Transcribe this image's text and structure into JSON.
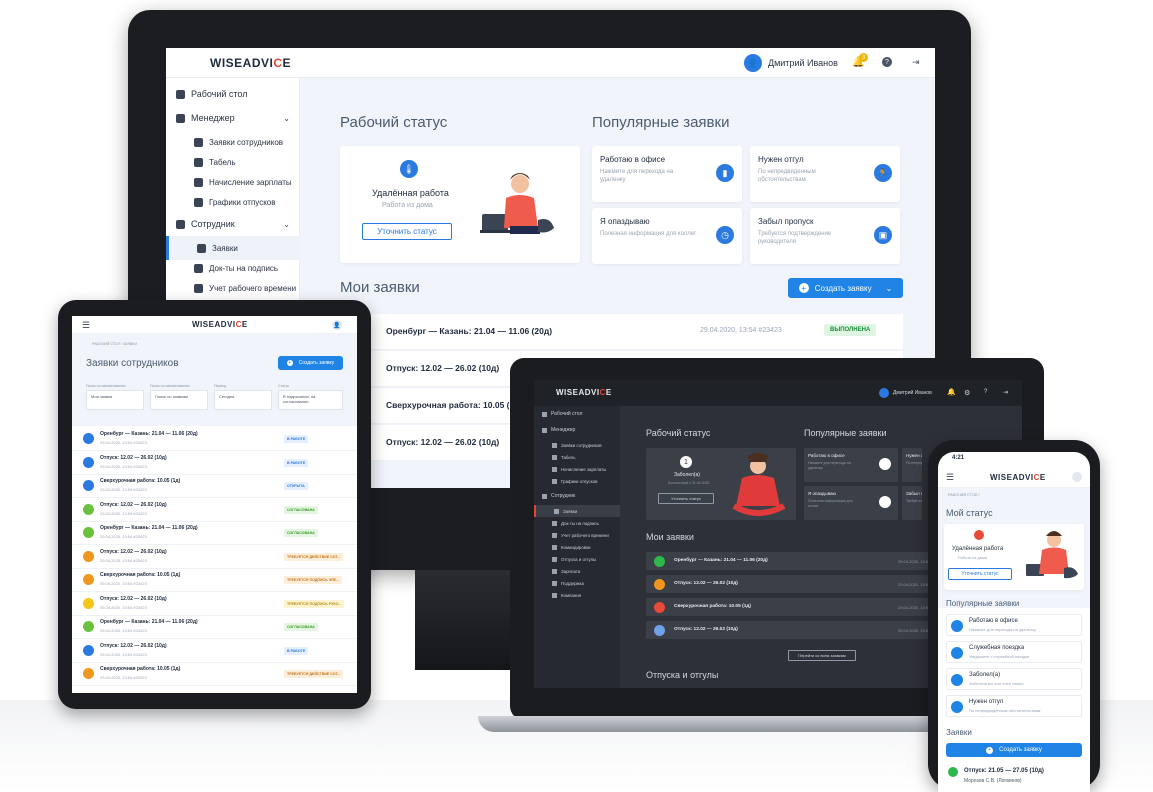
{
  "brand": {
    "prefix": "WISEADV",
    "k": "I",
    "ke": "C",
    "suffix": "E"
  },
  "monitor": {
    "user_name": "Дмитрий Иванов",
    "notif_count": "3",
    "sidebar": [
      {
        "label": "Рабочий стол",
        "level": 0
      },
      {
        "label": "Менеджер",
        "level": 0,
        "chevron": "⌄"
      },
      {
        "label": "Заявки сотрудников",
        "level": 1
      },
      {
        "label": "Табель",
        "level": 1
      },
      {
        "label": "Начисление зарплаты",
        "level": 1
      },
      {
        "label": "Графики отпусков",
        "level": 1
      },
      {
        "label": "Сотрудник",
        "level": 0,
        "chevron": "⌄"
      },
      {
        "label": "Заявки",
        "level": 1,
        "active": true
      },
      {
        "label": "Док-ты на подпись",
        "level": 1
      },
      {
        "label": "Учет рабочего времени",
        "level": 1
      }
    ],
    "status_title": "Рабочий статус",
    "status_card": {
      "title": "Удалённая работа",
      "subtitle": "Работа из дома",
      "button": "Уточнить статус"
    },
    "popular_title": "Популярные заявки",
    "popular": [
      {
        "title": "Работаю в офисе",
        "desc": "Нажмите для перехода на удаленку",
        "icon": "▮"
      },
      {
        "title": "Нужен отгул",
        "desc": "По непредвиденным обстоятельствам",
        "icon": "🏃"
      },
      {
        "title": "Я опаздываю",
        "desc": "Полезная информация для коллег",
        "icon": "◷"
      },
      {
        "title": "Забыл пропуск",
        "desc": "Требуется подтверждение руководителя",
        "icon": "▣"
      }
    ],
    "my_title": "Мои заявки",
    "create_btn": "Создать заявку",
    "rows": [
      {
        "title": "Оренбург — Казань: 21.04 — 11.06 (20д)",
        "date": "29.04.2020, 13:54 #23423",
        "badge": "ВЫПОЛНЕНА",
        "color": "#2eb84b"
      },
      {
        "title": "Отпуск: 12.02 — 26.02 (10д)",
        "date": "",
        "badge": "",
        "color": "#f5a623"
      },
      {
        "title": "Сверхурочная работа: 10.05 (1д",
        "date": "",
        "badge": "",
        "color": "#e84b3a"
      },
      {
        "title": "Отпуск: 12.02 — 26.02 (10д)",
        "date": "",
        "badge": "",
        "color": "#2a7ae2"
      }
    ]
  },
  "tablet": {
    "breadcrumb": "РАБОЧИЙ СТОЛ  /  ЗАЯВКИ",
    "title": "Заявки сотрудников",
    "create_btn": "Создать заявку",
    "filters": [
      {
        "label": "Поиск по наименованию",
        "value": "Мои заявки"
      },
      {
        "label": "Поиск по наименованию",
        "value": "Поиск по заявкам"
      },
      {
        "label": "Период",
        "value": "Сегодня"
      },
      {
        "label": "Статус",
        "value": "В подписании, на согласовании"
      }
    ],
    "rows": [
      {
        "title": "Оренбург — Казань: 21.04 — 11.06 (20д)",
        "date": "29.04.2020, 13:54 #23423",
        "badge": "В РАБОТЕ",
        "color": "#2a7ae2",
        "bbg": "#e4efff",
        "bfg": "#2a7ae2"
      },
      {
        "title": "Отпуск: 12.02 — 26.02 (10д)",
        "date": "29.04.2020, 13:54 #23423",
        "badge": "В РАБОТЕ",
        "color": "#2a7ae2",
        "bbg": "#e4efff",
        "bfg": "#2a7ae2"
      },
      {
        "title": "Сверхурочная работа: 10.05 (1д)",
        "date": "29.04.2020, 13:54 #23423",
        "badge": "ОТКРЫТА",
        "color": "#2a7ae2",
        "bbg": "#e4efff",
        "bfg": "#2a7ae2"
      },
      {
        "title": "Отпуск: 12.02 — 26.02 (10д)",
        "date": "29.04.2020, 13:54 #23423",
        "badge": "СОГЛАСОВАНА",
        "color": "#69c23b",
        "bbg": "#e3f6df",
        "bfg": "#3a9a2c"
      },
      {
        "title": "Оренбург — Казань: 21.04 — 11.06 (20д)",
        "date": "29.04.2020, 13:54 #23423",
        "badge": "СОГЛАСОВАНА",
        "color": "#69c23b",
        "bbg": "#e3f6df",
        "bfg": "#3a9a2c"
      },
      {
        "title": "Отпуск: 12.02 — 26.02 (10д)",
        "date": "29.04.2020, 13:54 #23423",
        "badge": "ТРЕБУЕТСЯ ДЕЙСТВИЕ СОТ...",
        "color": "#f0961f",
        "bbg": "#fdeed9",
        "bfg": "#c4741a"
      },
      {
        "title": "Сверхурочная работа: 10.05 (1д)",
        "date": "29.04.2020, 13:54 #23423",
        "badge": "ТРЕБУЕТСЯ ПОДПИСЬ ЭЛЕ...",
        "color": "#f0961f",
        "bbg": "#fdeed9",
        "bfg": "#c4741a"
      },
      {
        "title": "Отпуск: 12.02 — 26.02 (10д)",
        "date": "29.04.2020, 13:54 #23423",
        "badge": "ТРЕБУЕТСЯ ПОДПИСЬ РУКО...",
        "color": "#f5c518",
        "bbg": "#fdf3d0",
        "bfg": "#b88f0a"
      },
      {
        "title": "Оренбург — Казань: 21.04 — 11.06 (20д)",
        "date": "29.04.2020, 13:54 #23423",
        "badge": "СОГЛАСОВАНА",
        "color": "#69c23b",
        "bbg": "#e3f6df",
        "bfg": "#3a9a2c"
      },
      {
        "title": "Отпуск: 12.02 — 26.02 (10д)",
        "date": "29.04.2020, 13:54 #23423",
        "badge": "В РАБОТЕ",
        "color": "#2a7ae2",
        "bbg": "#e4efff",
        "bfg": "#2a7ae2"
      },
      {
        "title": "Сверхурочная работа: 10.05 (1д)",
        "date": "29.04.2020, 13:54 #23423",
        "badge": "ТРЕБУЕТСЯ ДЕЙСТВИЕ СОТ...",
        "color": "#f0961f",
        "bbg": "#fdeed9",
        "bfg": "#c4741a"
      }
    ]
  },
  "laptop": {
    "user_name": "Дмитрий Иванов",
    "sidebar": [
      {
        "label": "Рабочий стол",
        "level": 0
      },
      {
        "label": "Менеджер",
        "level": 0
      },
      {
        "label": "Заявки сотрудников",
        "level": 1
      },
      {
        "label": "Табель",
        "level": 1
      },
      {
        "label": "Начисление зарплаты",
        "level": 1
      },
      {
        "label": "Графики отпусков",
        "level": 1
      },
      {
        "label": "Сотрудник",
        "level": 0
      },
      {
        "label": "Заявки",
        "level": 1,
        "active": true
      },
      {
        "label": "Док-ты на подпись",
        "level": 1
      },
      {
        "label": "Учет рабочего времени",
        "level": 1
      },
      {
        "label": "Командировки",
        "level": 1
      },
      {
        "label": "Отпуска и отгулы",
        "level": 1
      },
      {
        "label": "Зарплата",
        "level": 1
      },
      {
        "label": "Поддержка",
        "level": 1
      },
      {
        "label": "Компания",
        "level": 1
      }
    ],
    "status_title": "Рабочий статус",
    "status_card": {
      "title": "Заболел(а)",
      "subtitle": "Больничный с 21.04.2020",
      "button": "Уточнить статус"
    },
    "popular_title": "Популярные заявки",
    "popular": [
      {
        "title": "Работаю в офисе",
        "desc": "Нажмите для перехода на удаленку"
      },
      {
        "title": "Нужен от",
        "desc": "По непредв обстоят"
      },
      {
        "title": "Я опаздываю",
        "desc": "Полезная информация для коллег"
      },
      {
        "title": "Забыл пр",
        "desc": "Требуется руководит"
      }
    ],
    "my_title": "Мои заявки",
    "rows": [
      {
        "title": "Оренбург — Казань: 21.04 — 11.06 (20д)",
        "date": "29.04.2020, 13:54 #23423",
        "color": "#2eb84b"
      },
      {
        "title": "Отпуск: 12.02 — 26.02 (10д)",
        "date": "29.04.2020, 13:54 #23423",
        "color": "#f0961f"
      },
      {
        "title": "Сверхурочная работа: 10.05 (1д)",
        "date": "29.04.2020, 13:54 #23423",
        "color": "#e84b3a"
      },
      {
        "title": "Отпуск: 12.02 — 26.02 (10д)",
        "date": "29.04.2020, 13:54 #23423",
        "color": "#6fa2e6"
      }
    ],
    "all_btn": "Перейти ко всем заявкам",
    "vacation_title": "Отпуска и отгулы"
  },
  "phone": {
    "time": "4:21",
    "breadcrumb": "РАБОЧИЙ СТОЛ  /",
    "status_title": "Мой статус",
    "status_card": {
      "title": "Удалённая работа",
      "subtitle": "Работа из дома",
      "button": "Уточнить статус"
    },
    "popular_title": "Популярные заявки",
    "popular": [
      {
        "title": "Работаю в офисе",
        "desc": "Нажмите для перехода на удаленку"
      },
      {
        "title": "Служебная поездка",
        "desc": "Уведомите о служебной поездке"
      },
      {
        "title": "Заболел(а)",
        "desc": "Заболели вы или член семьи"
      },
      {
        "title": "Нужен отгул",
        "desc": "По непредвиденным обстоятельствам"
      }
    ],
    "requests_title": "Заявки",
    "create_btn": "Создать заявку",
    "last_row": {
      "title": "Отпуск: 21.05 — 27.05 (10д)",
      "sub": "Морозов С.В. (Логвинов)"
    }
  }
}
